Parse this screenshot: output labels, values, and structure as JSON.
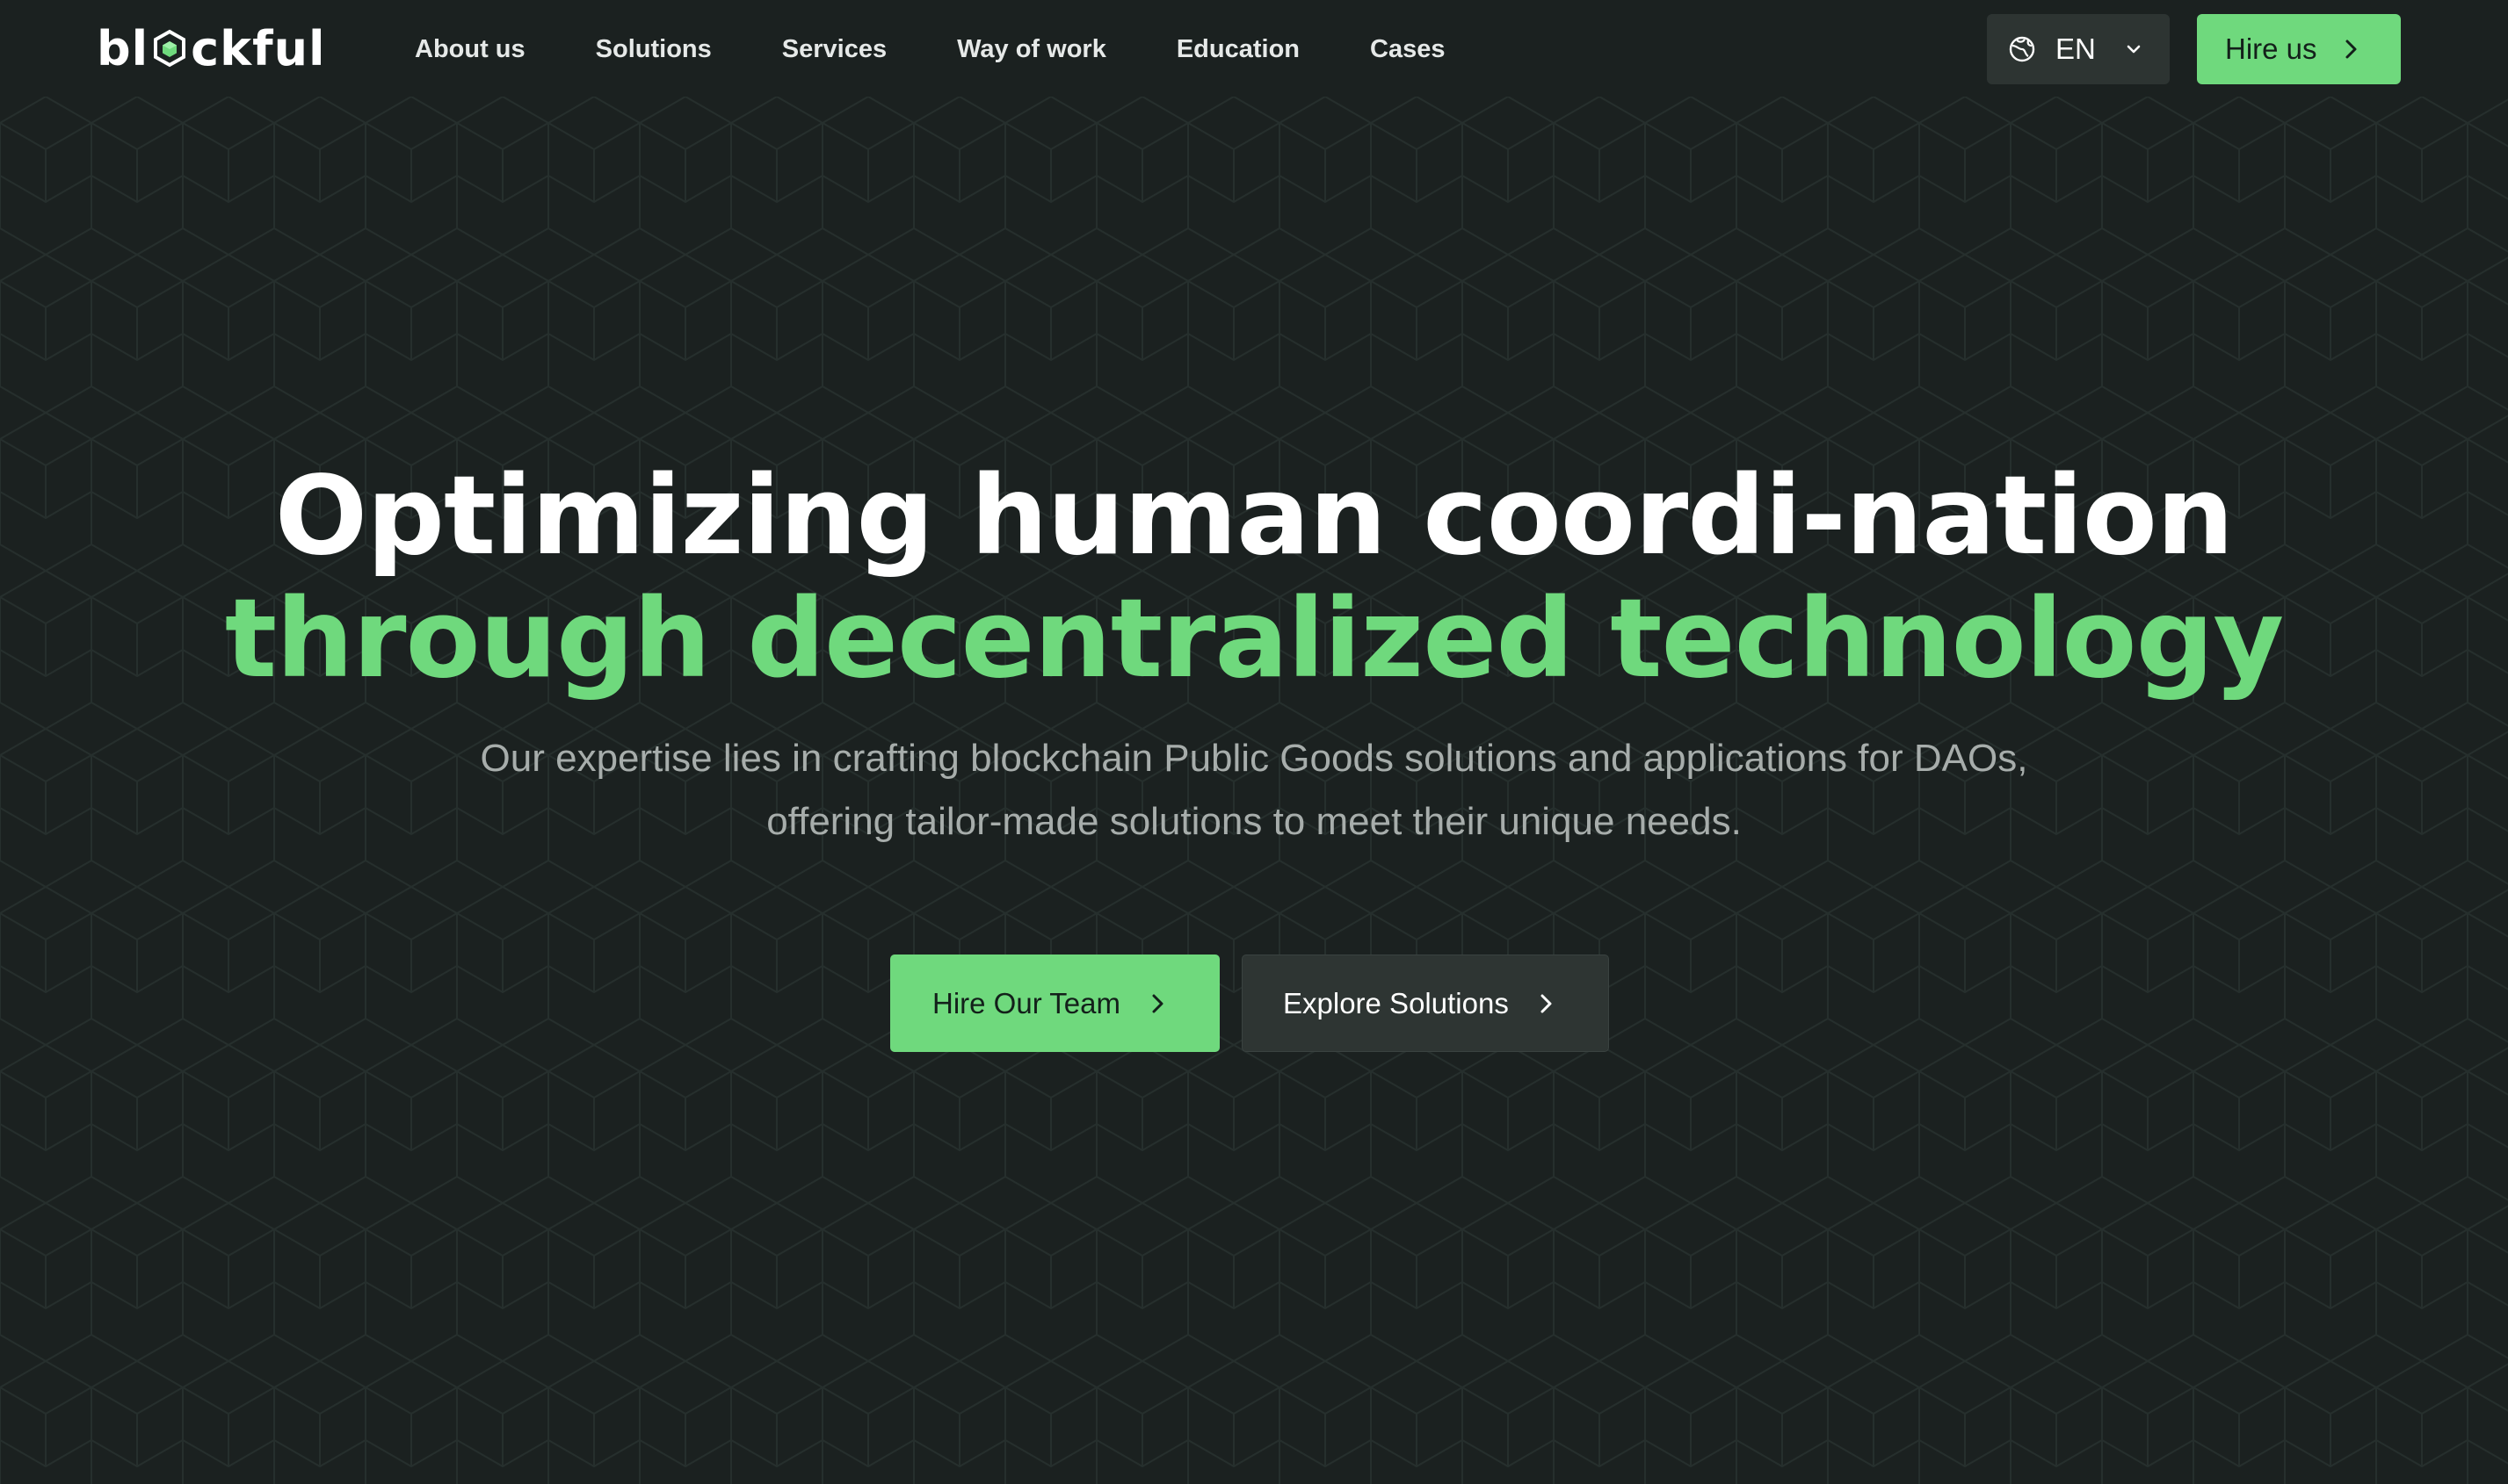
{
  "header": {
    "logo": {
      "prefix": "bl",
      "suffix": "ckful",
      "icon": "cube-logo-icon"
    },
    "nav": [
      {
        "label": "About us"
      },
      {
        "label": "Solutions"
      },
      {
        "label": "Services"
      },
      {
        "label": "Way of work"
      },
      {
        "label": "Education"
      },
      {
        "label": "Cases"
      }
    ],
    "language": {
      "value": "EN",
      "icon": "globe-icon"
    },
    "hire_button": {
      "label": "Hire us",
      "icon": "chevron-right-icon"
    }
  },
  "hero": {
    "title_line1": "Optimizing human coordi-nation",
    "title_line2": "through decentralized technology",
    "subtitle_line1": "Our expertise lies in crafting blockchain Public Goods solutions and applications for DAOs,",
    "subtitle_line2": "offering tailor-made solutions to meet their unique needs.",
    "primary_cta": {
      "label": "Hire Our Team",
      "icon": "chevron-right-icon"
    },
    "secondary_cta": {
      "label": "Explore Solutions",
      "icon": "chevron-right-icon"
    }
  },
  "colors": {
    "background": "#1b2120",
    "accent": "#6fd97d",
    "muted_text": "#a7adab",
    "secondary_button": "#2e3533"
  }
}
